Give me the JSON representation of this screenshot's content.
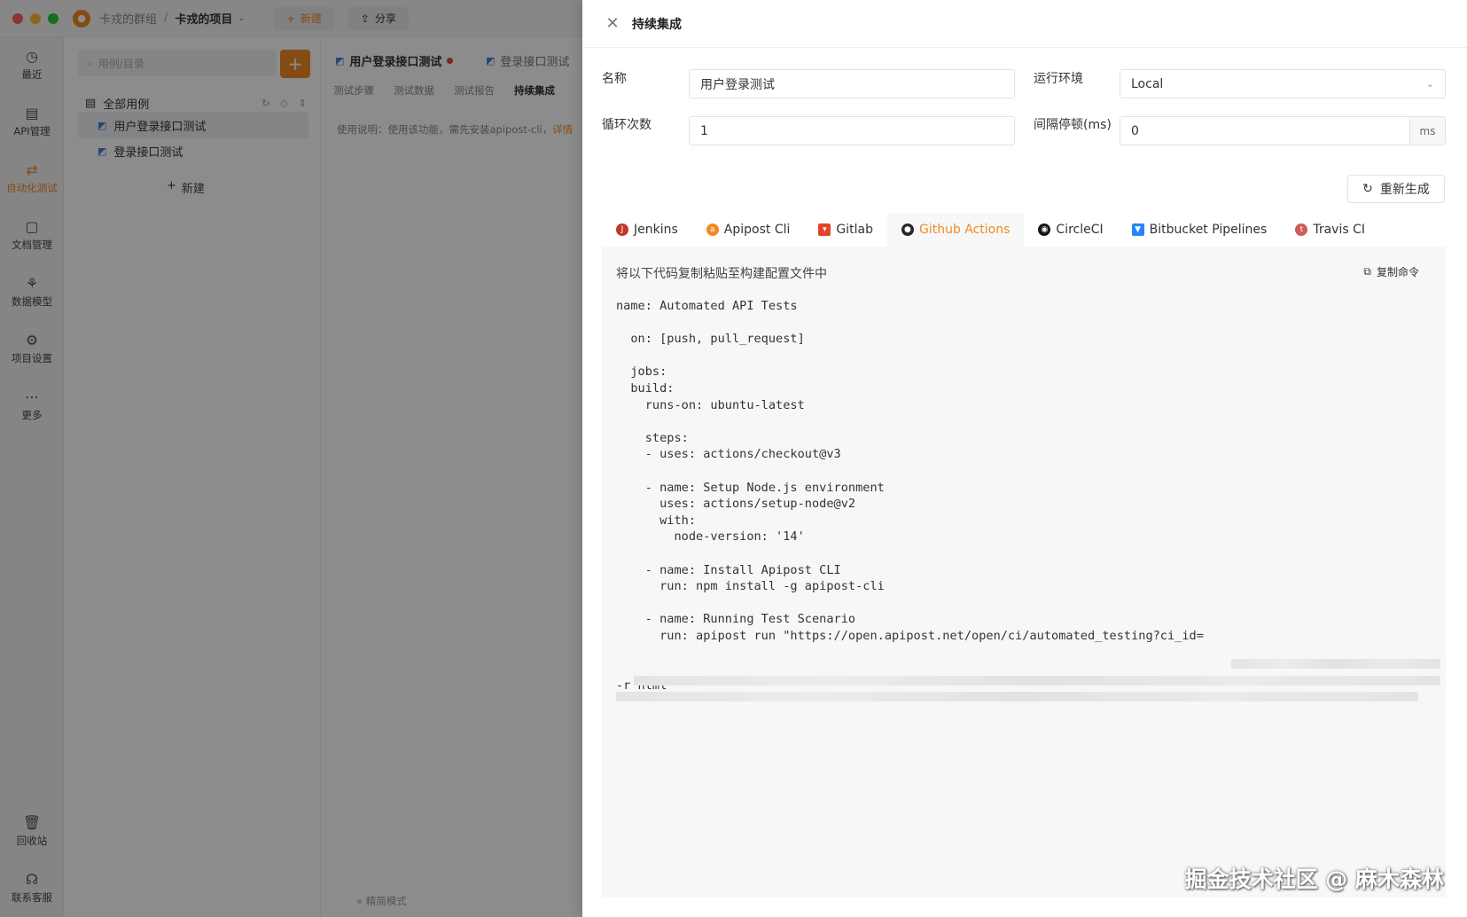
{
  "titlebar": {
    "team": "卡戎的群组",
    "separator": "/",
    "project": "卡戎的项目",
    "new_label": "新建",
    "share_label": "分享"
  },
  "rail": {
    "items": [
      {
        "label": "最近",
        "icon": "clock-icon"
      },
      {
        "label": "API管理",
        "icon": "api-icon"
      },
      {
        "label": "自动化测试",
        "icon": "automation-icon"
      },
      {
        "label": "文档管理",
        "icon": "document-icon"
      },
      {
        "label": "数据模型",
        "icon": "data-model-icon"
      },
      {
        "label": "项目设置",
        "icon": "settings-icon"
      },
      {
        "label": "更多",
        "icon": "more-icon"
      }
    ],
    "bottom": [
      {
        "label": "回收站",
        "icon": "trash-icon"
      },
      {
        "label": "联系客服",
        "icon": "headset-icon"
      }
    ]
  },
  "tree": {
    "search_placeholder": "用例/目录",
    "root_label": "全部用例",
    "items": [
      "用户登录接口测试",
      "登录接口测试"
    ],
    "new_label": "新建"
  },
  "main": {
    "tabs": [
      "用户登录接口测试",
      "登录接口测试"
    ],
    "sub_tabs": [
      "测试步骤",
      "测试数据",
      "测试报告",
      "持续集成"
    ],
    "usage_text": "使用说明：使用该功能，需先安装apipost-cli，",
    "usage_link": "详情",
    "simple_mode": "精简模式"
  },
  "drawer": {
    "title": "持续集成",
    "form": {
      "name_label": "名称",
      "name_value": "用户登录测试",
      "env_label": "运行环境",
      "env_value": "Local",
      "loop_label": "循环次数",
      "loop_value": "1",
      "interval_label": "间隔停顿(ms)",
      "interval_value": "0",
      "interval_unit": "ms"
    },
    "regen_label": "重新生成",
    "ci_tabs": [
      {
        "label": "Jenkins",
        "icon": "jenkins-icon",
        "color": "#c0392b"
      },
      {
        "label": "Apipost Cli",
        "icon": "apipost-icon",
        "color": "#f08a24"
      },
      {
        "label": "Gitlab",
        "icon": "gitlab-icon",
        "color": "#e24329"
      },
      {
        "label": "Github Actions",
        "icon": "github-icon",
        "color": "#24292e"
      },
      {
        "label": "CircleCI",
        "icon": "circleci-icon",
        "color": "#161616"
      },
      {
        "label": "Bitbucket Pipelines",
        "icon": "bitbucket-icon",
        "color": "#2684ff"
      },
      {
        "label": "Travis CI",
        "icon": "travis-icon",
        "color": "#cd5c5c"
      }
    ],
    "active_tab": 3,
    "code_hint": "将以下代码复制粘贴至构建配置文件中",
    "copy_label": "复制命令",
    "code_lines": [
      "name: Automated API Tests",
      "",
      "  on: [push, pull_request]",
      "",
      "  jobs:",
      "  build:",
      "    runs-on: ubuntu-latest",
      "",
      "    steps:",
      "    - uses: actions/checkout@v3",
      "",
      "    - name: Setup Node.js environment",
      "      uses: actions/setup-node@v2",
      "      with:",
      "        node-version: '14'",
      "",
      "    - name: Install Apipost CLI",
      "      run: npm install -g apipost-cli",
      "",
      "    - name: Running Test Scenario",
      "      run: apipost run \"https://open.apipost.net/open/ci/automated_testing?ci_id=",
      "",
      "                                                                                         \"",
      "-r html"
    ]
  },
  "watermark": "掘金技术社区 @ 麻木森林",
  "colors": {
    "accent": "#f08a24",
    "overlay": "rgba(0,0,0,0.45)",
    "code_bg": "#f7f7f7"
  }
}
